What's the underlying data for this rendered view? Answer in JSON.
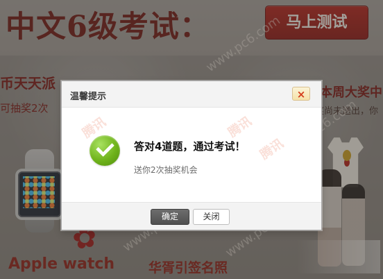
{
  "background": {
    "banner_text": "中文6级考试：",
    "cta_label": "马上测试",
    "left_promo": "币天天派",
    "left_promo_sub": "可抽奖2次",
    "right_promo": "本周大奖中",
    "right_promo_sub": "奖尚未送出，你",
    "bottom_left_caption": "Apple watch",
    "bottom_mid_caption": "华胥引签名照"
  },
  "dialog": {
    "title": "温馨提示",
    "close_symbol": "×",
    "heading": "答对4道题，通过考试！",
    "subtext": "送你2次抽奖机会",
    "confirm_label": "确定",
    "close_label": "关闭"
  },
  "colors": {
    "accent_red": "#8e1713",
    "success_green": "#6fb31b",
    "dialog_bg": "#ffffff",
    "overlay": "#3c3834"
  }
}
